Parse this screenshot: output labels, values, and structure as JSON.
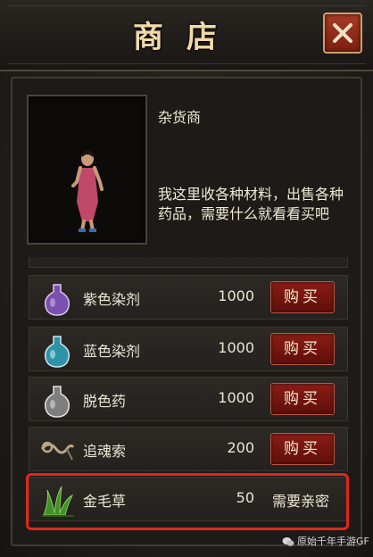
{
  "window": {
    "title": "商店"
  },
  "npc": {
    "name": "杂货商",
    "dialog": "我这里收各种材料，出售各种药品，需要什么就看看买吧"
  },
  "items": [
    {
      "name": "紫色染剂",
      "price": "1000",
      "action": "购买",
      "icon": "purple-potion-icon",
      "color": "#8a5bb8"
    },
    {
      "name": "蓝色染剂",
      "price": "1000",
      "action": "购买",
      "icon": "blue-potion-icon",
      "color": "#3fa3b8"
    },
    {
      "name": "脱色药",
      "price": "1000",
      "action": "购买",
      "icon": "grey-potion-icon",
      "color": "#8a8a8a"
    },
    {
      "name": "追魂索",
      "price": "200",
      "action": "购买",
      "icon": "rope-icon",
      "color": "#9a8a70"
    },
    {
      "name": "金毛草",
      "price": "50",
      "action": "需要亲密",
      "icon": "herb-icon",
      "color": "#3f8a2a"
    }
  ],
  "watermark": "原始千年手游GF"
}
